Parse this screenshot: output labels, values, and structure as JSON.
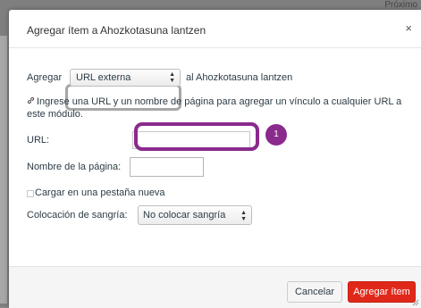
{
  "background": {
    "top_right_text": "Próximo"
  },
  "dialog": {
    "title": "Agregar ítem a Ahozkotasuna lantzen",
    "close_glyph": "×"
  },
  "form": {
    "add_prefix": "Agregar",
    "type_select_value": "URL externa",
    "add_suffix": "al Ahozkotasuna lantzen",
    "help_text": "Ingrese una URL y un nombre de página para agregar un vínculo a cualquier URL a este módulo.",
    "url_label": "URL:",
    "url_value": "",
    "page_name_label": "Nombre de la página:",
    "page_name_value": "",
    "new_tab_label": "Cargar en una pestaña nueva",
    "indent_label": "Colocación de sangría:",
    "indent_value": "No colocar sangría"
  },
  "annotation": {
    "callout_number": "1",
    "color": "#8a2a8c"
  },
  "footer": {
    "cancel_label": "Cancelar",
    "add_label": "Agregar ítem"
  },
  "colors": {
    "primary_button": "#e0281a",
    "overlay": "#7f7f7f"
  }
}
